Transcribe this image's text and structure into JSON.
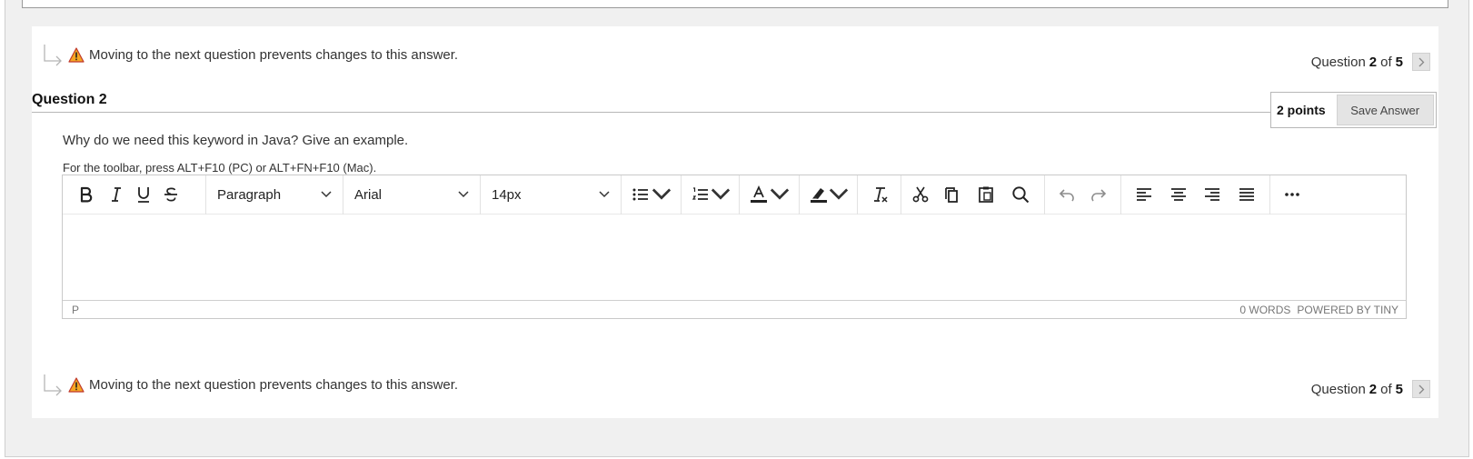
{
  "notice_top": {
    "text": "Moving to the next question prevents changes to this answer."
  },
  "notice_bottom": {
    "text": "Moving to the next question prevents changes to this answer."
  },
  "nav_top": {
    "prefix": "Question",
    "current": "2",
    "of": "of",
    "total": "5"
  },
  "nav_bottom": {
    "prefix": "Question",
    "current": "2",
    "of": "of",
    "total": "5"
  },
  "question": {
    "title": "Question 2",
    "points": "2 points",
    "save_label": "Save Answer",
    "text": "Why do we need this keyword in Java? Give an example."
  },
  "editor": {
    "hint": "For the toolbar, press ALT+F10 (PC) or ALT+FN+F10 (Mac).",
    "block_format": "Paragraph",
    "font_family": "Arial",
    "font_size": "14px",
    "status_path": "P",
    "word_count": "0 WORDS",
    "powered_by": "POWERED BY TINY",
    "content": ""
  },
  "colors": {
    "warning": "#f5a623",
    "accent_border": "#b7b7b7",
    "background": "#f0f0f0"
  },
  "icons": [
    "arrow-icon",
    "warning-icon",
    "chevron-right-icon",
    "bold-icon",
    "italic-icon",
    "underline-icon",
    "strikethrough-icon",
    "bullet-list-icon",
    "numbered-list-icon",
    "text-color-icon",
    "highlight-icon",
    "clear-formatting-icon",
    "cut-icon",
    "copy-icon",
    "paste-icon",
    "search-icon",
    "undo-icon",
    "redo-icon",
    "align-left-icon",
    "align-center-icon",
    "align-right-icon",
    "justify-icon",
    "more-icon"
  ]
}
